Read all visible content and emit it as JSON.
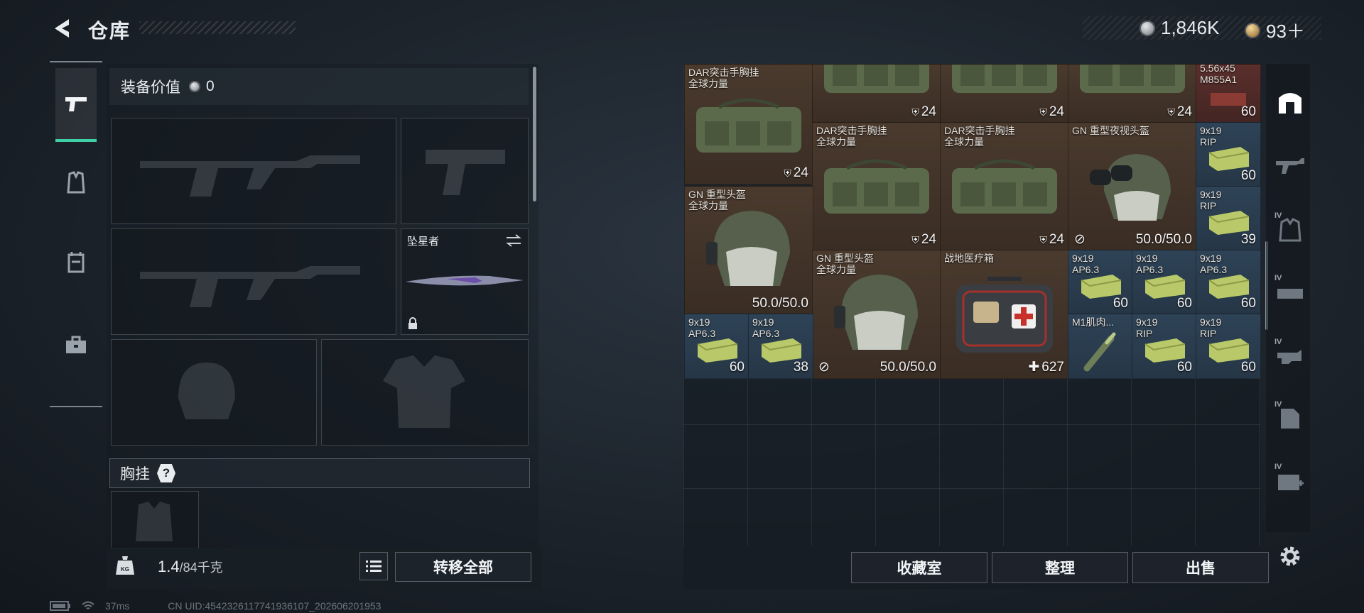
{
  "header": {
    "title": "仓库",
    "silver": "1,846K",
    "gold": "93＋"
  },
  "loadout": {
    "value_label": "装备价值",
    "value": "0",
    "melee_name": "坠星者",
    "chest_label": "胸挂",
    "help": "?",
    "weight_current": "1.4",
    "weight_max": "/84千克",
    "transfer_all": "转移全部"
  },
  "stash": {
    "items": [
      {
        "name": "DAR突击手胸挂\n全球力量",
        "qty": "24"
      },
      {
        "name": "",
        "qty": "24"
      },
      {
        "name": "",
        "qty": "24"
      },
      {
        "name": "",
        "qty": "24"
      },
      {
        "name": "5.56x45\nM855A1",
        "qty": "60"
      },
      {
        "name": "DAR突击手胸挂\n全球力量",
        "qty": "24"
      },
      {
        "name": "DAR突击手胸挂\n全球力量",
        "qty": "24"
      },
      {
        "name": "GN 重型夜视头盔",
        "qty": "50.0/50.0"
      },
      {
        "name": "9x19\nRIP",
        "qty": "60"
      },
      {
        "name": "GN 重型头盔\n全球力量",
        "qty": "50.0/50.0"
      },
      {
        "name": "9x19\nRIP",
        "qty": "39"
      },
      {
        "name": "GN 重型头盔\n全球力量",
        "qty": "50.0/50.0"
      },
      {
        "name": "战地医疗箱",
        "qty": "627"
      },
      {
        "name": "9x19\nAP6.3",
        "qty": "60"
      },
      {
        "name": "9x19\nAP6.3",
        "qty": "60"
      },
      {
        "name": "9x19\nAP6.3",
        "qty": "60"
      },
      {
        "name": "9x19\nAP6.3",
        "qty": "60"
      },
      {
        "name": "9x19\nAP6.3",
        "qty": "38"
      },
      {
        "name": "M1肌肉...",
        "qty": ""
      },
      {
        "name": "9x19\nRIP",
        "qty": "60"
      },
      {
        "name": "9x19\nRIP",
        "qty": "60"
      }
    ],
    "collection_btn": "收藏室",
    "sort_btn": "整理",
    "sell_btn": "出售"
  },
  "right_tabs": {
    "tier_label": "IV"
  },
  "status_bar": {
    "ping": "37ms",
    "uid": "CN UID:4542326117741936107_202606201953"
  }
}
